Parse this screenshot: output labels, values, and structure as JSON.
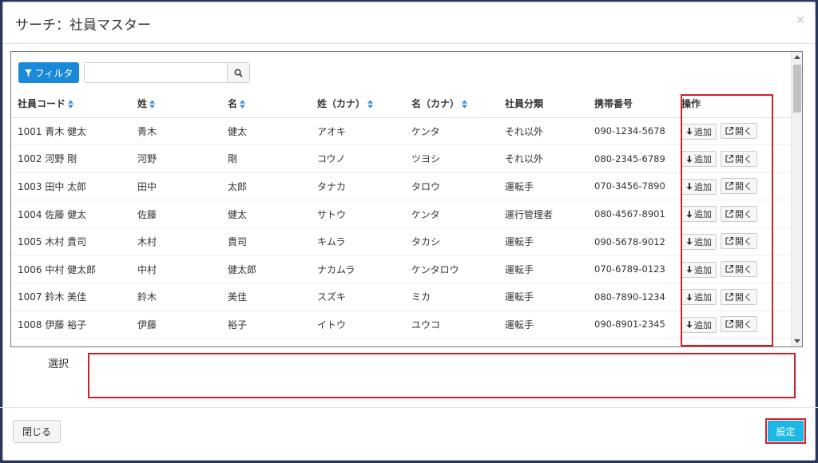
{
  "modal": {
    "title": "サーチ：社員マスター",
    "close_glyph": "×"
  },
  "toolbar": {
    "filter_label": "フィルタ",
    "search_placeholder": "",
    "search_value": ""
  },
  "table": {
    "columns": [
      "社員コード",
      "姓",
      "名",
      "姓（カナ）",
      "名（カナ）",
      "社員分類",
      "携帯番号",
      "操作"
    ],
    "rows": [
      [
        "1001 青木 健太",
        "青木",
        "健太",
        "アオキ",
        "ケンタ",
        "それ以外",
        "090-1234-5678"
      ],
      [
        "1002 河野 剛",
        "河野",
        "剛",
        "コウノ",
        "ツヨシ",
        "それ以外",
        "080-2345-6789"
      ],
      [
        "1003 田中 太郎",
        "田中",
        "太郎",
        "タナカ",
        "タロウ",
        "運転手",
        "070-3456-7890"
      ],
      [
        "1004 佐藤 健太",
        "佐藤",
        "健太",
        "サトウ",
        "ケンタ",
        "運行管理者",
        "080-4567-8901"
      ],
      [
        "1005 木村 貴司",
        "木村",
        "貴司",
        "キムラ",
        "タカシ",
        "運転手",
        "090-5678-9012"
      ],
      [
        "1006 中村 健太郎",
        "中村",
        "健太郎",
        "ナカムラ",
        "ケンタロウ",
        "運転手",
        "070-6789-0123"
      ],
      [
        "1007 鈴木 美佳",
        "鈴木",
        "美佳",
        "スズキ",
        "ミカ",
        "運転手",
        "080-7890-1234"
      ],
      [
        "1008 伊藤 裕子",
        "伊藤",
        "裕子",
        "イトウ",
        "ユウコ",
        "運転手",
        "090-8901-2345"
      ]
    ],
    "add_label": "追加",
    "open_label": "開く"
  },
  "selection": {
    "label": "選択",
    "value": ""
  },
  "footer": {
    "close_label": "閉じる",
    "set_label": "設定"
  },
  "colors": {
    "primary": "#1a8ad8",
    "set_button": "#1cb8e8",
    "highlight": "#d21f2a"
  }
}
